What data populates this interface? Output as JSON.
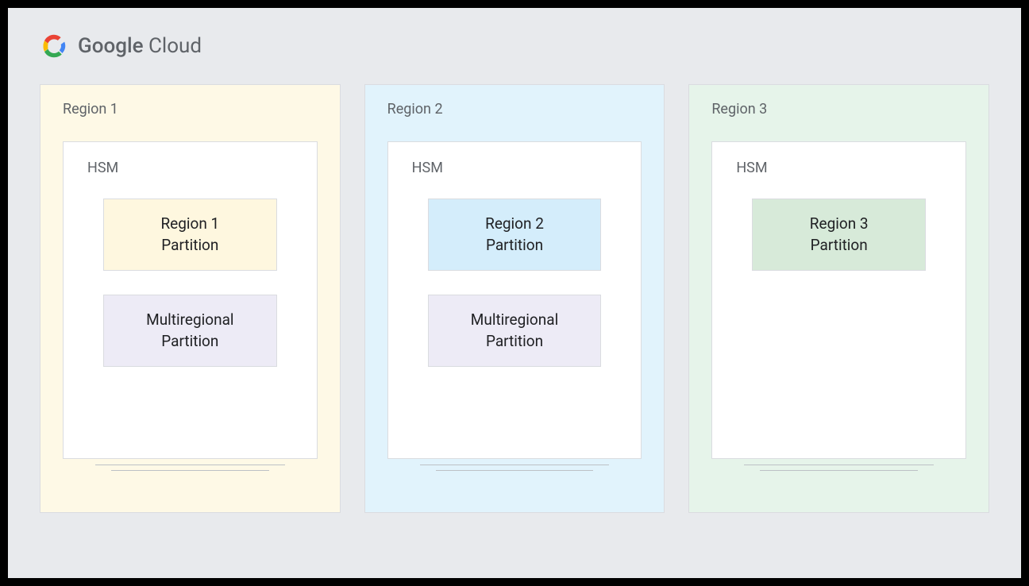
{
  "brand": {
    "google": "Google",
    "cloud": " Cloud"
  },
  "regions": [
    {
      "label": "Region 1",
      "hsm_label": "HSM",
      "partitions": [
        {
          "line1": "Region 1",
          "line2": "Partition",
          "style": "partition-r1"
        },
        {
          "line1": "Multiregional",
          "line2": "Partition",
          "style": "partition-multi"
        }
      ]
    },
    {
      "label": "Region 2",
      "hsm_label": "HSM",
      "partitions": [
        {
          "line1": "Region 2",
          "line2": "Partition",
          "style": "partition-r2"
        },
        {
          "line1": "Multiregional",
          "line2": "Partition",
          "style": "partition-multi"
        }
      ]
    },
    {
      "label": "Region 3",
      "hsm_label": "HSM",
      "partitions": [
        {
          "line1": "Region 3",
          "line2": "Partition",
          "style": "partition-r3"
        }
      ]
    }
  ]
}
